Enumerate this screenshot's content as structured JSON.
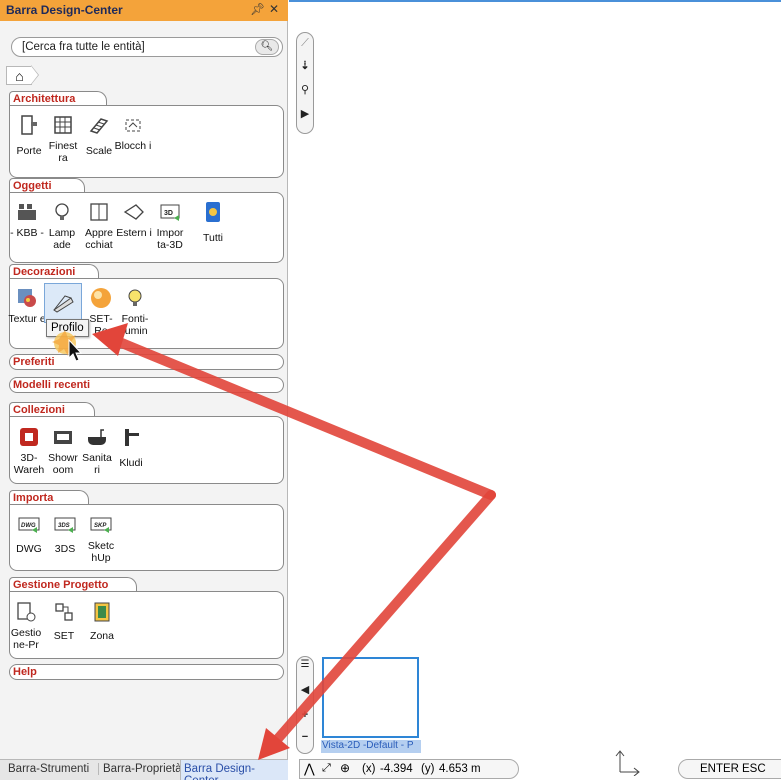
{
  "panel": {
    "title": "Barra Design-Center",
    "pin_glyph": "⊕",
    "close_glyph": "✕",
    "search_placeholder": "[Cerca fra tutte le entità]"
  },
  "sections": {
    "architettura": {
      "title": "Architettura",
      "items": [
        {
          "label": "Porte",
          "icon": "door-icon"
        },
        {
          "label": "Finest ra",
          "icon": "window-icon"
        },
        {
          "label": "Scale",
          "icon": "stairs-icon"
        },
        {
          "label": "Blocch i",
          "icon": "blocks-icon"
        }
      ]
    },
    "oggetti": {
      "title": "Oggetti",
      "items": [
        {
          "label": "- KBB -",
          "icon": "kitchen-icon"
        },
        {
          "label": "Lamp ade",
          "icon": "lamp-icon"
        },
        {
          "label": "Appre cchiat",
          "icon": "appliance-icon"
        },
        {
          "label": "Estern i",
          "icon": "exterior-icon"
        },
        {
          "label": "Impor ta-3D",
          "icon": "import-3d-icon"
        },
        {
          "label": "Tutti",
          "icon": "all-icon"
        }
      ]
    },
    "decorazioni": {
      "title": "Decorazioni",
      "items": [
        {
          "label": "Textur e",
          "icon": "texture-icon"
        },
        {
          "label": "Profilo",
          "icon": "profile-icon"
        },
        {
          "label": "SET- Re",
          "icon": "set-render-icon"
        },
        {
          "label": "Fonti- lumin",
          "icon": "light-source-icon"
        }
      ]
    },
    "preferiti": {
      "title": "Preferiti"
    },
    "modelli_recenti": {
      "title": "Modelli recenti"
    },
    "collezioni": {
      "title": "Collezioni",
      "items": [
        {
          "label": "3D- Wareh",
          "icon": "warehouse-icon"
        },
        {
          "label": "Showr oom",
          "icon": "showroom-icon"
        },
        {
          "label": "Sanita ri",
          "icon": "sanitary-icon"
        },
        {
          "label": "Kludi",
          "icon": "faucet-icon"
        }
      ]
    },
    "importa": {
      "title": "Importa",
      "items": [
        {
          "label": "DWG",
          "icon": "dwg-icon"
        },
        {
          "label": "3DS",
          "icon": "3ds-icon"
        },
        {
          "label": "Sketc hUp",
          "icon": "sketchup-icon"
        }
      ]
    },
    "gestione": {
      "title": "Gestione Progetto",
      "items": [
        {
          "label": "Gestio ne-Pr",
          "icon": "project-manager-icon"
        },
        {
          "label": "SET",
          "icon": "set-icon"
        },
        {
          "label": "Zona",
          "icon": "zone-icon"
        }
      ]
    },
    "help": {
      "title": "Help"
    }
  },
  "tooltip": "Profilo",
  "bottom_tabs": [
    "Barra-Strumenti",
    "Barra-Proprietà",
    "Barra Design-Center"
  ],
  "viewport": {
    "thumbnail_label": "Vista-2D -Default - P"
  },
  "status": {
    "x_label": "(x)",
    "x_value": "-4.394",
    "y_label": "(y)",
    "y_value": "4.653 m",
    "enter": "ENTER",
    "esc": "ESC"
  },
  "colors": {
    "title_bar": "#f4a33a",
    "section_title": "#c0281f",
    "annotation_arrow": "#e2453a",
    "active_tab": "#2a4fa8"
  }
}
